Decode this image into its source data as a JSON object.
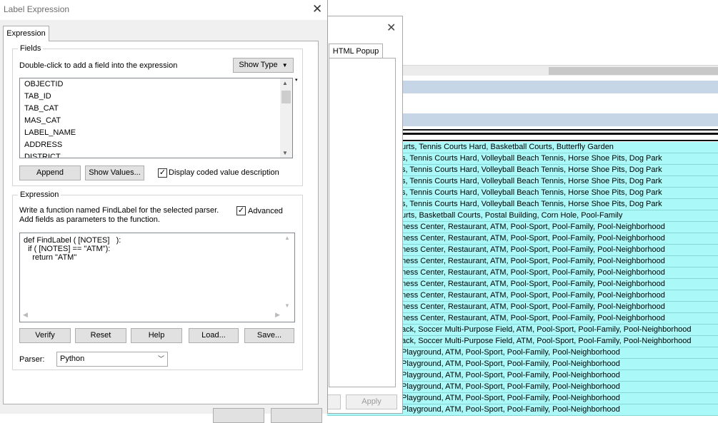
{
  "dialog": {
    "title": "Label Expression",
    "tab": "Expression",
    "fields_group": {
      "label": "Fields",
      "instruction": "Double-click to add a field into the expression",
      "show_type_label": "Show Type",
      "fields": [
        "OBJECTID",
        "TAB_ID",
        "TAB_CAT",
        "MAS_CAT",
        "LABEL_NAME",
        "ADDRESS",
        "DISTRICT"
      ],
      "append_label": "Append",
      "show_values_label": "Show Values...",
      "display_coded_label": "Display coded value description",
      "display_coded_checked": true
    },
    "expression_group": {
      "label": "Expression",
      "instruction_line1": "Write a function named FindLabel for the selected parser.",
      "instruction_line2": "Add fields as parameters to the function.",
      "advanced_label": "Advanced",
      "advanced_checked": true,
      "code_lines": [
        "def FindLabel ( [NOTES]   ):",
        "  if ( [NOTES] == \"ATM\"):",
        "    return \"ATM\""
      ],
      "buttons": {
        "verify": "Verify",
        "reset": "Reset",
        "help": "Help",
        "load": "Load...",
        "save": "Save..."
      },
      "parser_label": "Parser:",
      "parser_value": "Python"
    }
  },
  "mid_dialog": {
    "tab": "HTML Popup",
    "apply_label": "Apply"
  },
  "table": {
    "rows": [
      "urts, Tennis Courts Hard, Basketball Courts, Butterfly Garden",
      "s, Tennis Courts Hard, Volleyball Beach Tennis, Horse Shoe Pits, Dog Park",
      "s, Tennis Courts Hard, Volleyball Beach Tennis, Horse Shoe Pits, Dog Park",
      "s, Tennis Courts Hard, Volleyball Beach Tennis, Horse Shoe Pits, Dog Park",
      "s, Tennis Courts Hard, Volleyball Beach Tennis, Horse Shoe Pits, Dog Park",
      "s, Tennis Courts Hard, Volleyball Beach Tennis, Horse Shoe Pits, Dog Park",
      "urts, Basketball Courts, Postal Building, Corn Hole, Pool-Family",
      "ness Center, Restaurant, ATM, Pool-Sport, Pool-Family, Pool-Neighborhood",
      "ness Center, Restaurant, ATM, Pool-Sport, Pool-Family, Pool-Neighborhood",
      "ness Center, Restaurant, ATM, Pool-Sport, Pool-Family, Pool-Neighborhood",
      "ness Center, Restaurant, ATM, Pool-Sport, Pool-Family, Pool-Neighborhood",
      "ness Center, Restaurant, ATM, Pool-Sport, Pool-Family, Pool-Neighborhood",
      "ness Center, Restaurant, ATM, Pool-Sport, Pool-Family, Pool-Neighborhood",
      "ness Center, Restaurant, ATM, Pool-Sport, Pool-Family, Pool-Neighborhood",
      "ness Center, Restaurant, ATM, Pool-Sport, Pool-Family, Pool-Neighborhood",
      "ness Center, Restaurant, ATM, Pool-Sport, Pool-Family, Pool-Neighborhood",
      "ack, Soccer Multi-Purpose Field, ATM, Pool-Sport, Pool-Family, Pool-Neighborhood",
      "ack, Soccer Multi-Purpose Field, ATM, Pool-Sport, Pool-Family, Pool-Neighborhood",
      "Playground, ATM, Pool-Sport, Pool-Family, Pool-Neighborhood",
      "Playground, ATM, Pool-Sport, Pool-Family, Pool-Neighborhood",
      "Playground, ATM, Pool-Sport, Pool-Family, Pool-Neighborhood",
      "Playground, ATM, Pool-Sport, Pool-Family, Pool-Neighborhood",
      "Playground, ATM, Pool-Sport, Pool-Family, Pool-Neighborhood",
      "Playground, ATM, Pool-Sport, Pool-Family, Pool-Neighborhood"
    ]
  },
  "colors": {
    "row_bg": "#aaf8f8",
    "band_bg": "#c6d6e6",
    "dialog_bg": "#f0f0f0"
  }
}
